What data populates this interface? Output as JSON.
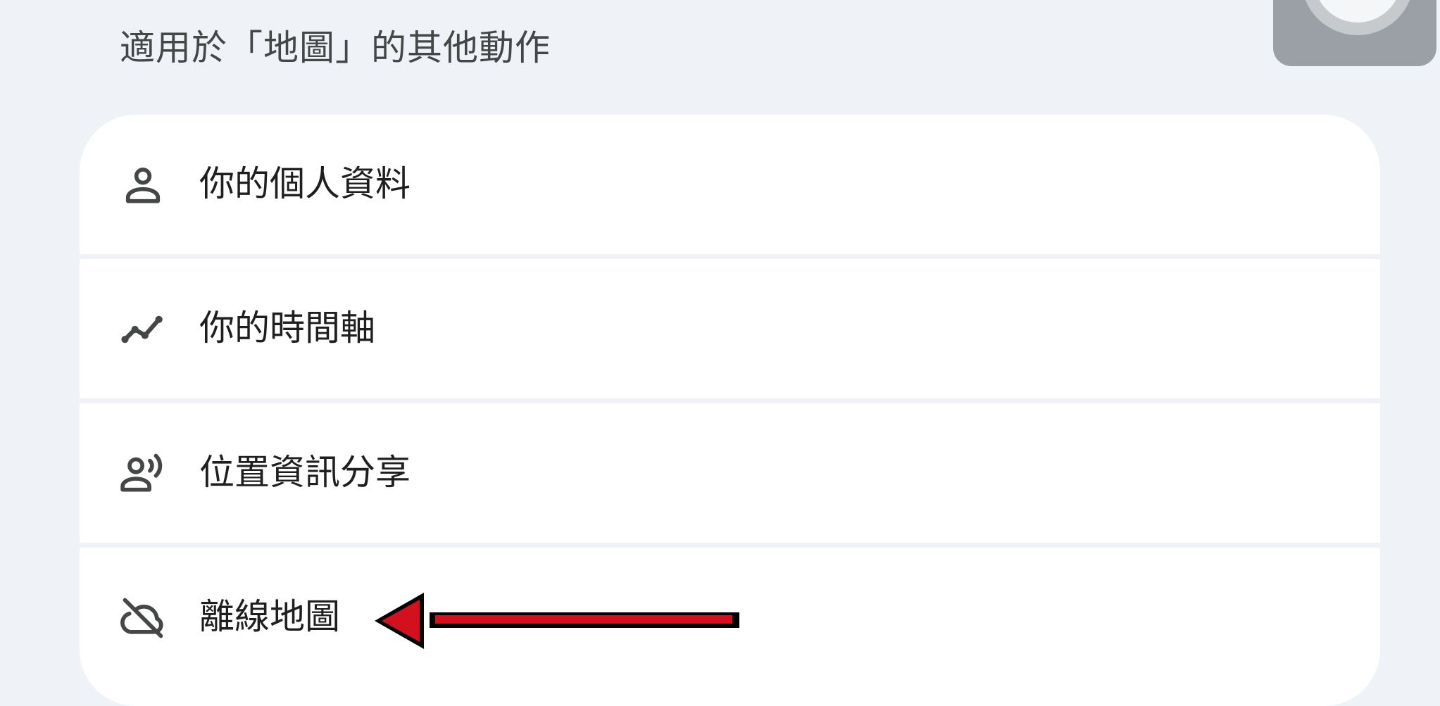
{
  "section": {
    "title": "適用於「地圖」的其他動作"
  },
  "menu": {
    "items": [
      {
        "icon": "person-icon",
        "label": "你的個人資料"
      },
      {
        "icon": "timeline-icon",
        "label": "你的時間軸"
      },
      {
        "icon": "location-sharing-icon",
        "label": "位置資訊分享"
      },
      {
        "icon": "cloud-off-icon",
        "label": "離線地圖"
      }
    ]
  },
  "colors": {
    "background": "#eff3f8",
    "card": "#ffffff",
    "icon": "#444746",
    "text": "#1f1f1f",
    "annotation_arrow": "#d2101e"
  }
}
